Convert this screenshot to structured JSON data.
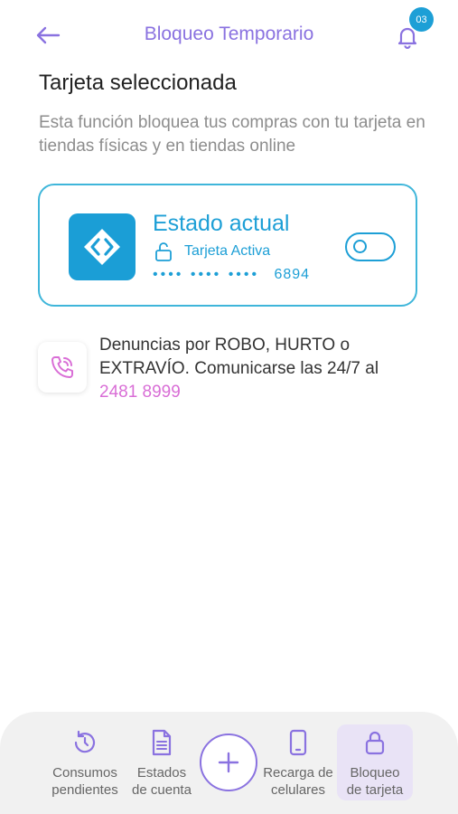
{
  "header": {
    "title": "Bloqueo Temporario",
    "notification_count": "03"
  },
  "section": {
    "title": "Tarjeta seleccionada",
    "description": "Esta función bloquea tus compras con tu tarjeta en tiendas físicas y en tiendas online"
  },
  "card": {
    "status_title": "Estado actual",
    "status_text": "Tarjeta Activa",
    "masked_digits": "•••• •••• ••••",
    "last_digits": "6894",
    "toggle_state": "on"
  },
  "report": {
    "text": "Denuncias por ROBO, HURTO o EXTRAVÍO. Comunicarse las 24/7 al",
    "phone": "2481 8999"
  },
  "bottom_nav": {
    "items": [
      {
        "label_line1": "Consumos",
        "label_line2": "pendientes",
        "icon": "history-icon"
      },
      {
        "label_line1": "Estados",
        "label_line2": "de cuenta",
        "icon": "document-icon"
      },
      {
        "label_line1": "Recarga de",
        "label_line2": "celulares",
        "icon": "phone-icon"
      },
      {
        "label_line1": "Bloqueo",
        "label_line2": "de tarjeta",
        "icon": "lock-icon",
        "active": true
      }
    ],
    "fab_icon": "plus-icon"
  },
  "colors": {
    "accent_purple": "#8a72e0",
    "accent_blue": "#1d9fd6",
    "phone_pink": "#d96ed6"
  }
}
